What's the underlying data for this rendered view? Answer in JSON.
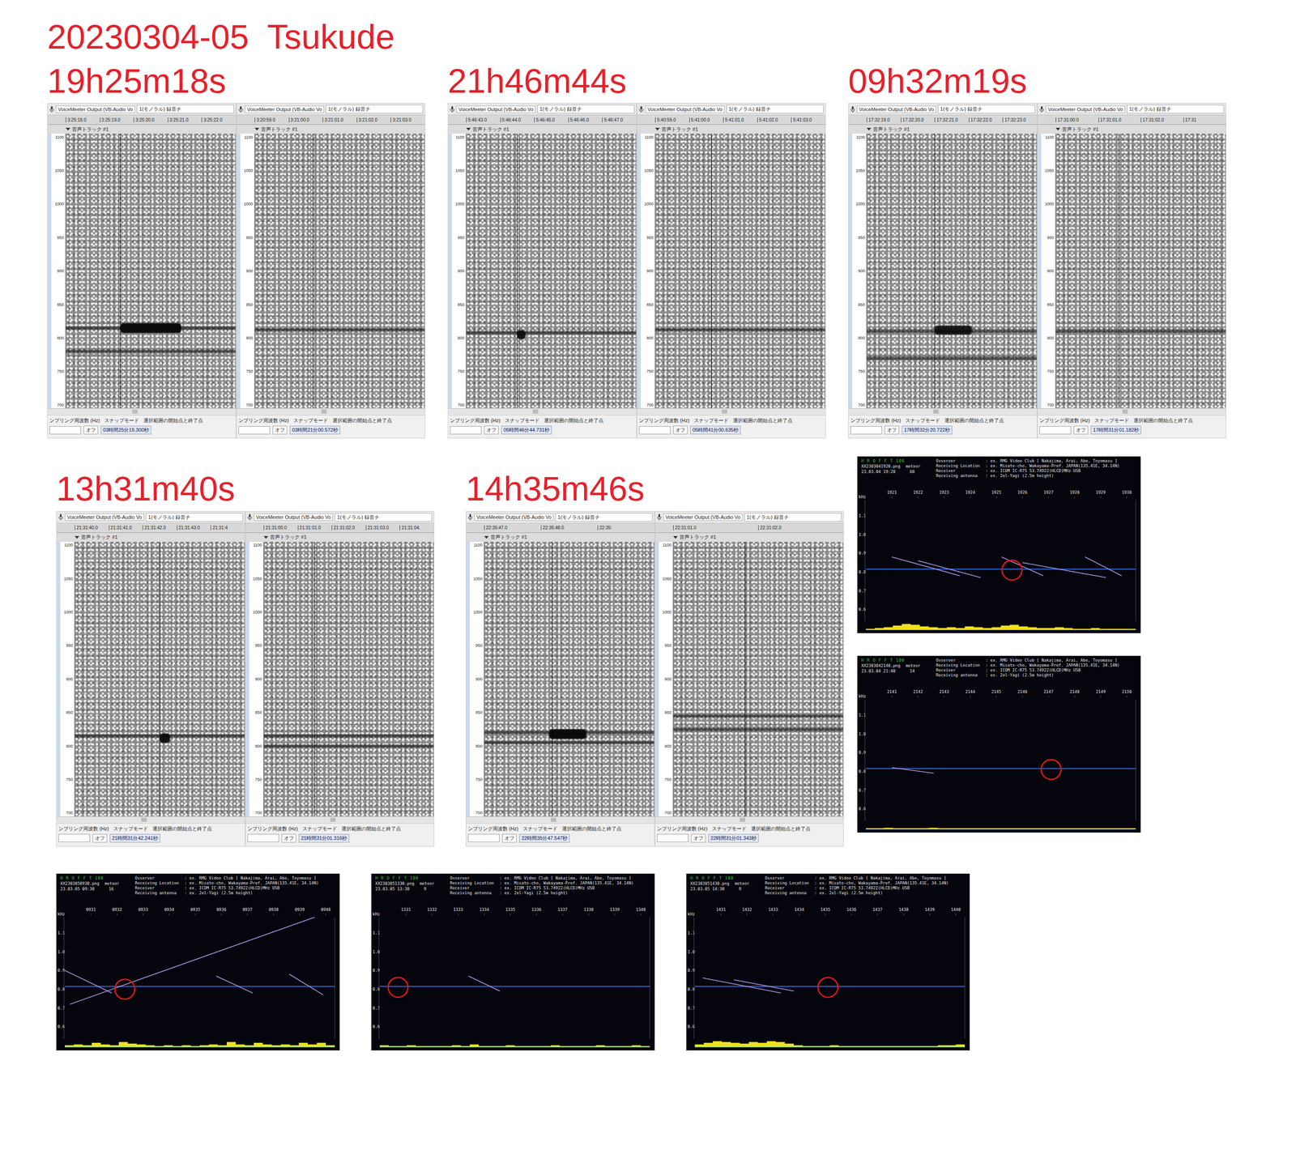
{
  "title": "20230304-05  Tsukude",
  "spectrogram_labels": {
    "device": "VoiceMeeter Output (VB-Audio Vo",
    "channel": "1(モノラル) 録音チ",
    "track": "音声トラック #1",
    "yticks": [
      "1100",
      "1050",
      "1000",
      "950",
      "900",
      "850",
      "800",
      "750",
      "700"
    ],
    "sample_rate_label": "ンプリング周波数 (Hz)",
    "snap_label": "スナップモード",
    "selection_label": "選択範囲の開始点と終了点",
    "snap_value": "オフ"
  },
  "events": [
    {
      "heading": "19h25m18s",
      "shots": [
        {
          "ticks": [
            "3:25:18.0",
            "3:25:19.0",
            "3:25:20.0",
            "3:25:21.0",
            "3:25:22.0"
          ],
          "time": "03時間25分19.300秒",
          "cursor": 0.32,
          "carriers": [
            815,
            780
          ],
          "echo": {
            "start": 0.32,
            "end": 0.68,
            "hz": 815,
            "strength": 1.0
          }
        },
        {
          "ticks": [
            "3:20:59.0",
            "3:21:00.0",
            "3:21:01.0",
            "3:21:02.0",
            "3:21:03.0"
          ],
          "time": "03時間21分00.572秒",
          "cursor": 0.34,
          "carriers": [
            812
          ],
          "echo": null
        }
      ]
    },
    {
      "heading": "21h46m44s",
      "shots": [
        {
          "ticks": [
            "5:46:43.0",
            "5:46:44.0",
            "5:46:45.0",
            "5:46:46.0",
            "5:46:47.0"
          ],
          "time": "05時間46分44.731秒",
          "cursor": 0.3,
          "carriers": [
            808
          ],
          "echo": {
            "start": 0.3,
            "end": 0.35,
            "hz": 805,
            "strength": 0.9
          }
        },
        {
          "ticks": [
            "5:40:59.0",
            "5:41:00.0",
            "5:41:01.0",
            "5:41:02.0",
            "5:41:03.0"
          ],
          "time": "05時間41分00.635秒",
          "cursor": 0.33,
          "carriers": [
            812
          ],
          "echo": null
        }
      ]
    },
    {
      "heading": "09h32m19s",
      "shots": [
        {
          "ticks": [
            "17:32:19.0",
            "17:32:20.0",
            "17:32:21.0",
            "17:32:22.0",
            "17:32:23.0"
          ],
          "time": "17時間32分20.722秒",
          "cursor": 0.4,
          "carriers": [
            810,
            770
          ],
          "echo": {
            "start": 0.4,
            "end": 0.62,
            "hz": 812,
            "strength": 0.8
          }
        },
        {
          "ticks": [
            "17:31:00.0",
            "17:31:01.0",
            "17:31:02.0",
            "17:31"
          ],
          "time": "17時間31分01.182秒",
          "cursor": 0.37,
          "carriers": [
            810
          ],
          "echo": null
        }
      ]
    },
    {
      "heading": "13h31m40s",
      "shots": [
        {
          "ticks": [
            "21:31:40.0",
            "21:31:41.0",
            "21:31:42.0",
            "21:31:43.0",
            "21:31:4"
          ],
          "time": "21時間31分42.241秒",
          "cursor": 0.5,
          "carriers": [
            815
          ],
          "echo": {
            "start": 0.5,
            "end": 0.56,
            "hz": 812,
            "strength": 0.9
          }
        },
        {
          "ticks": [
            "21:31:00.0",
            "21:31:01.0",
            "21:31:02.0",
            "21:31:03.0",
            "21:31:04."
          ],
          "time": "21時間31分01.316秒",
          "cursor": 0.3,
          "carriers": [
            815,
            800
          ],
          "echo": null
        }
      ]
    },
    {
      "heading": "14h35m46s",
      "shots": [
        {
          "ticks": [
            "22:35:47.0",
            "22:35:48.0",
            "22:35:"
          ],
          "time": "22時間35分47.547秒",
          "cursor": 0.4,
          "carriers": [
            820,
            805
          ],
          "echo": {
            "start": 0.38,
            "end": 0.6,
            "hz": 818,
            "strength": 1.0
          }
        },
        {
          "ticks": [
            "22:31:01.0",
            "22:31:02.0"
          ],
          "time": "22時間31分01.343秒",
          "cursor": 0.42,
          "carriers": [
            845,
            825
          ],
          "echo": null
        }
      ]
    }
  ],
  "hrofft_labels": {
    "brand": "H R O F F T 100",
    "meteor_label": "meteor",
    "khz": "kHz",
    "yticks": [
      "1.1",
      "1.0",
      "0.9",
      "0.8",
      "0.7",
      "0.6"
    ],
    "rows": [
      {
        "label": "Ovserver",
        "value": ": ex. RMG Video Club [ Nakajima, Arai, Abe, Toyomasu ]"
      },
      {
        "label": "Receiving Location",
        "value": ": ex. Misato-cho, Wakayama-Pref. JAPAN(135.41E, 34.14N)"
      },
      {
        "label": "Receiver",
        "value": ": ex. ICOM IC-R75 53.74922(HLCD)MHz USB"
      },
      {
        "label": "Receiving antenna",
        "value": ": ex. 2el-Yagi (2.5m height)"
      }
    ]
  },
  "hrofft": [
    {
      "file": "XX2303041920.png",
      "count": "68",
      "date": "23.03.04 19:20",
      "ticks": [
        "1921",
        "1922",
        "1923",
        "1924",
        "1925",
        "1926",
        "1927",
        "1928",
        "1929",
        "1930"
      ],
      "traces": [
        [
          1.0,
          0.88,
          3.6,
          0.78
        ],
        [
          2.0,
          0.86,
          4.4,
          0.77
        ],
        [
          5.2,
          0.88,
          6.8,
          0.78
        ],
        [
          6.0,
          0.85,
          9.2,
          0.77
        ],
        [
          8.4,
          0.88,
          9.8,
          0.78
        ]
      ],
      "circle": [
        5.6,
        0.81
      ],
      "activity": [
        0.1,
        0.2,
        0.3,
        0.5,
        0.7,
        0.6,
        0.4,
        0.3,
        0.2,
        0.3,
        0.2,
        0.4,
        0.3,
        0.2,
        0.3,
        0.5,
        0.6,
        0.4,
        0.3,
        0.2,
        0.2,
        0.3,
        0.2,
        0.1,
        0.1,
        0.2,
        0.1,
        0.1,
        0.1,
        0.1
      ]
    },
    {
      "file": "XX2303042140.png",
      "count": "14",
      "date": "23.03.04 21:40",
      "ticks": [
        "2141",
        "2142",
        "2143",
        "2144",
        "2145",
        "2146",
        "2147",
        "2148",
        "2149",
        "2150"
      ],
      "traces": [
        [
          1.0,
          0.82,
          2.6,
          0.79
        ]
      ],
      "circle": [
        7.1,
        0.81
      ],
      "activity": [
        0.1,
        0.1,
        0.15,
        0.1,
        0.1,
        0.1,
        0.1,
        0.15,
        0.1,
        0.1,
        0.1,
        0.1,
        0.1,
        0.1,
        0.1,
        0.1,
        0.1,
        0.1,
        0.1,
        0.1,
        0.1,
        0.1,
        0.1,
        0.1,
        0.1,
        0.1,
        0.1,
        0.1,
        0.1,
        0.1
      ]
    },
    {
      "file": "XX2303050930.png",
      "count": "16",
      "date": "23.03.05 09:30",
      "ticks": [
        "0931",
        "0932",
        "0933",
        "0934",
        "0935",
        "0936",
        "0937",
        "0938",
        "0939",
        "0940"
      ],
      "traces": [
        [
          0.0,
          0.9,
          1.8,
          0.78
        ],
        [
          0.2,
          0.72,
          9.9,
          1.2
        ],
        [
          5.8,
          0.87,
          7.2,
          0.78
        ],
        [
          8.6,
          0.88,
          9.9,
          0.77
        ]
      ],
      "circle": [
        2.3,
        0.8
      ],
      "activity": [
        0.2,
        0.3,
        0.2,
        0.5,
        0.3,
        0.2,
        0.6,
        0.4,
        0.3,
        0.2,
        0.1,
        0.2,
        0.1,
        0.2,
        0.1,
        0.2,
        0.3,
        0.2,
        0.6,
        0.3,
        0.2,
        0.5,
        0.3,
        0.2,
        0.3,
        0.2,
        0.5,
        0.3,
        0.5,
        0.2
      ]
    },
    {
      "file": "XX2303051330.png",
      "count": "9",
      "date": "23.03.05 13:30",
      "ticks": [
        "1331",
        "1332",
        "1333",
        "1334",
        "1335",
        "1336",
        "1337",
        "1338",
        "1339",
        "1340"
      ],
      "traces": [
        [
          3.4,
          0.87,
          4.6,
          0.79
        ]
      ],
      "circle": [
        0.7,
        0.81
      ],
      "activity": [
        0.2,
        0.1,
        0.1,
        0.2,
        0.1,
        0.1,
        0.1,
        0.1,
        0.2,
        0.1,
        0.3,
        0.1,
        0.1,
        0.1,
        0.2,
        0.1,
        0.1,
        0.1,
        0.1,
        0.2,
        0.1,
        0.1,
        0.1,
        0.1,
        0.2,
        0.1,
        0.1,
        0.1,
        0.2,
        0.1
      ]
    },
    {
      "file": "XX2303051430.png",
      "count": "9",
      "date": "23.03.05 14:30",
      "ticks": [
        "1431",
        "1432",
        "1433",
        "1434",
        "1435",
        "1436",
        "1437",
        "1438",
        "1439",
        "1440"
      ],
      "traces": [
        [
          0.3,
          0.86,
          3.3,
          0.78
        ],
        [
          1.5,
          0.85,
          3.8,
          0.79
        ]
      ],
      "circle": [
        5.1,
        0.81
      ],
      "activity": [
        0.3,
        0.5,
        0.7,
        0.6,
        0.5,
        0.4,
        0.6,
        0.5,
        0.7,
        0.6,
        0.4,
        0.2,
        0.1,
        0.1,
        0.1,
        0.2,
        0.1,
        0.1,
        0.1,
        0.1,
        0.1,
        0.1,
        0.1,
        0.1,
        0.1,
        0.1,
        0.1,
        0.2,
        0.2,
        0.3
      ]
    }
  ]
}
